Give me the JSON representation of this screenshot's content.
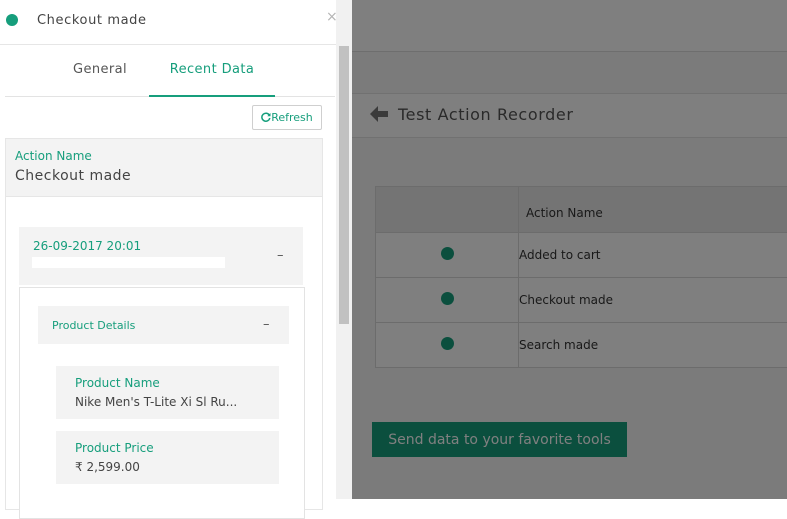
{
  "background": {
    "page_title": "Test Action Recorder",
    "table": {
      "column_header": "Action Name",
      "rows": [
        {
          "name": "Added to cart"
        },
        {
          "name": "Checkout made"
        },
        {
          "name": "Search made"
        }
      ]
    },
    "send_button": "Send data to your favorite tools"
  },
  "panel": {
    "title": "Checkout made",
    "close_label": "×",
    "tabs": [
      {
        "label": "General",
        "active": false
      },
      {
        "label": "Recent Data",
        "active": true
      }
    ],
    "refresh_label": "Refresh",
    "action_name_label": "Action Name",
    "action_name_value": "Checkout made",
    "entry": {
      "timestamp": "26-09-2017 20:01",
      "collapse_label": "–",
      "product_details": {
        "label": "Product Details",
        "collapse_label": "–",
        "fields": [
          {
            "label": "Product Name",
            "value": "Nike Men's T-Lite Xi Sl Ru..."
          },
          {
            "label": "Product Price",
            "value": "₹ 2,599.00"
          }
        ]
      }
    }
  },
  "colors": {
    "accent": "#169e7c",
    "overlay": "rgba(0,0,0,0.5)"
  },
  "icons": {
    "back": "arrow-left-icon",
    "refresh": "refresh-icon",
    "close": "close-icon",
    "status": "status-dot-icon"
  }
}
